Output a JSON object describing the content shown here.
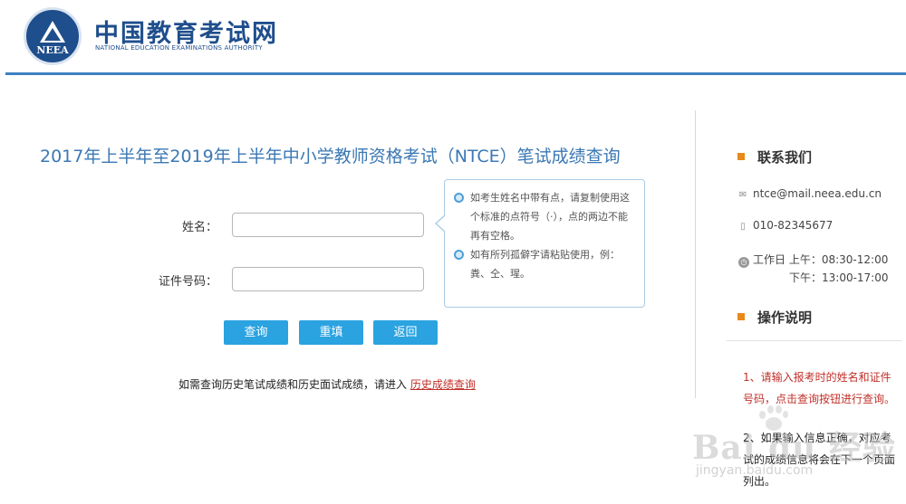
{
  "header": {
    "logo_text": "NEEA",
    "brand_cn": "中国教育考试网",
    "brand_en": "NATIONAL EDUCATION EXAMINATIONS AUTHORITY"
  },
  "main": {
    "title": "2017年上半年至2019年上半年中小学教师资格考试（NTCE）笔试成绩查询",
    "form": {
      "name_label": "姓名：",
      "name_value": "",
      "id_label": "证件号码：",
      "id_value": ""
    },
    "tips": [
      "如考生姓名中带有点，请复制使用这个标准的点符号（·），点的两边不能再有空格。",
      "如有所列孤僻字请粘贴使用，例：粪、仝、瑆。"
    ],
    "buttons": {
      "query": "查询",
      "reset": "重填",
      "back": "返回"
    },
    "history": {
      "text": "如需查询历史笔试成绩和历史面试成绩，请进入",
      "link": "历史成绩查询"
    }
  },
  "sidebar": {
    "contact_title": "联系我们",
    "email": "ntce@mail.neea.edu.cn",
    "phone": "010-82345677",
    "hours_label": "工作日",
    "morning": "上午：08:30-12:00",
    "afternoon": "下午：13:00-17:00",
    "instructions_title": "操作说明",
    "step1": "1、请输入报考时的姓名和证件号码，点击查询按钮进行查询。",
    "step2": "2、如果输入信息正确，对应考试的成绩信息将会在下一个页面列出。"
  },
  "watermark": {
    "big": "Bai du 经验",
    "small": "jingyan.baidu.com"
  },
  "colors": {
    "brand": "#1f4e8c",
    "title": "#3b78b4",
    "button": "#2aa3e0",
    "accent_square": "#e88a1a",
    "link_red": "#c0302a"
  }
}
